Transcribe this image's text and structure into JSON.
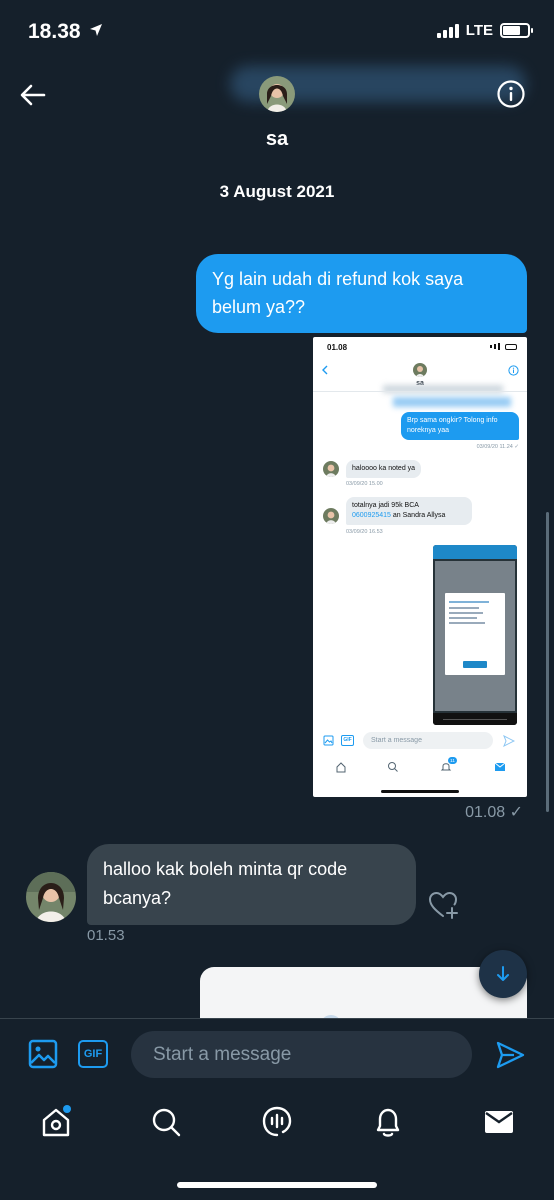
{
  "status_bar": {
    "time": "18.38",
    "network": "LTE"
  },
  "header": {
    "contact_name": "sa"
  },
  "date_separator": "3 August 2021",
  "messages": {
    "outgoing_text": "Yg lain udah di refund kok saya belum ya??",
    "attachment_time": "01.08 ✓",
    "incoming_text": "halloo kak boleh minta qr code bcanya?",
    "incoming_time": "01.53"
  },
  "screenshot": {
    "time": "01.08",
    "contact": "sa",
    "out_text": "Brp sama ongkir? Tolong info noreknya yaa",
    "out_ts": "03/09/20 11.24 ✓",
    "in1_text": "haloooo ka noted ya",
    "in1_ts": "03/09/20 15.00",
    "in2_text_a": "totalnya jadi 95k BCA",
    "in2_link": "0600925415",
    "in2_text_b": " an Sandra Allysa",
    "in2_ts": "03/09/20 16.53",
    "compose_placeholder": "Start a message",
    "gif_label": "GIF",
    "badge": "11"
  },
  "compose": {
    "placeholder": "Start a message",
    "gif_label": "GIF"
  },
  "tabs": [
    "home-icon",
    "search-icon",
    "spaces-icon",
    "notifications-icon",
    "messages-icon"
  ],
  "colors": {
    "background": "#15202b",
    "accent": "#1d9bf0",
    "incoming_bubble": "#38444d"
  }
}
